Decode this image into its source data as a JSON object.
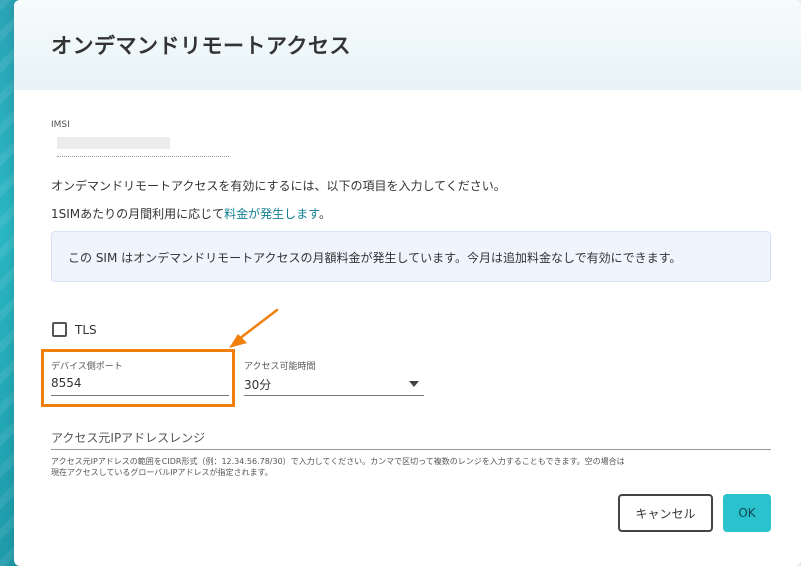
{
  "dialog": {
    "title": "オンデマンドリモートアクセス",
    "imsi_label": "IMSI",
    "intro_text": "オンデマンドリモートアクセスを有効にするには、以下の項目を入力してください。",
    "fee_prefix": "1SIMあたりの月間利用に応じて",
    "fee_link": "料金が発生します",
    "fee_suffix": "。",
    "info_message": "この SIM はオンデマンドリモートアクセスの月額料金が発生しています。今月は追加料金なしで有効にできます。"
  },
  "form": {
    "tls_label": "TLS",
    "tls_checked": false,
    "port_label": "デバイス側ポート",
    "port_value": "8554",
    "access_time_label": "アクセス可能時間",
    "access_time_value": "30分",
    "source_range_label": "アクセス元IPアドレスレンジ",
    "source_range_value": "",
    "help_line1": "アクセス元IPアドレスの範囲をCIDR形式（例：12.34.56.78/30）で入力してください。カンマで区切って複数のレンジを入力することもできます。空の場合は",
    "help_line2": "現在アクセスしているグローバルIPアドレスが指定されます。"
  },
  "buttons": {
    "cancel": "キャンセル",
    "ok": "OK"
  },
  "colors": {
    "accent": "#29c2cd",
    "link": "#127f93",
    "highlight": "#f07f0c",
    "info_bg": "#f0f4fd"
  }
}
